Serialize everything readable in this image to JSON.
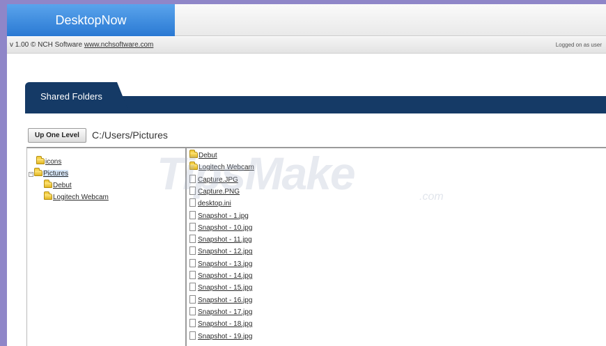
{
  "header": {
    "app_title": "DesktopNow",
    "version_text": "v 1.00 © NCH Software",
    "link_text": "www.nchsoftware.com",
    "logged_text": "Logged on as user"
  },
  "tabs": {
    "shared_folders": "Shared Folders"
  },
  "toolbar": {
    "up_one_level": "Up One Level",
    "current_path": "C:/Users/Pictures"
  },
  "tree": [
    {
      "label": "icons",
      "indent": 1,
      "expander": false,
      "selected": false
    },
    {
      "label": "Pictures",
      "indent": 0,
      "expander": true,
      "selected": true
    },
    {
      "label": "Debut",
      "indent": 2,
      "expander": false,
      "selected": false
    },
    {
      "label": "Logitech Webcam",
      "indent": 2,
      "expander": false,
      "selected": false
    }
  ],
  "files": [
    {
      "name": "Debut",
      "type": "folder"
    },
    {
      "name": "Logitech Webcam",
      "type": "folder"
    },
    {
      "name": "Capture.JPG",
      "type": "file"
    },
    {
      "name": "Capture.PNG",
      "type": "file"
    },
    {
      "name": "desktop.ini",
      "type": "file"
    },
    {
      "name": "Snapshot - 1.jpg",
      "type": "file"
    },
    {
      "name": "Snapshot - 10.jpg",
      "type": "file"
    },
    {
      "name": "Snapshot - 11.jpg",
      "type": "file"
    },
    {
      "name": "Snapshot - 12.jpg",
      "type": "file"
    },
    {
      "name": "Snapshot - 13.jpg",
      "type": "file"
    },
    {
      "name": "Snapshot - 14.jpg",
      "type": "file"
    },
    {
      "name": "Snapshot - 15.jpg",
      "type": "file"
    },
    {
      "name": "Snapshot - 16.jpg",
      "type": "file"
    },
    {
      "name": "Snapshot - 17.jpg",
      "type": "file"
    },
    {
      "name": "Snapshot - 18.jpg",
      "type": "file"
    },
    {
      "name": "Snapshot - 19.jpg",
      "type": "file"
    }
  ],
  "watermark": {
    "main": "TipsMake",
    "suffix": ".com"
  },
  "colors": {
    "brand": "#2f80d8",
    "nav_band": "#153a66",
    "outer_frame": "#8f86c8"
  }
}
